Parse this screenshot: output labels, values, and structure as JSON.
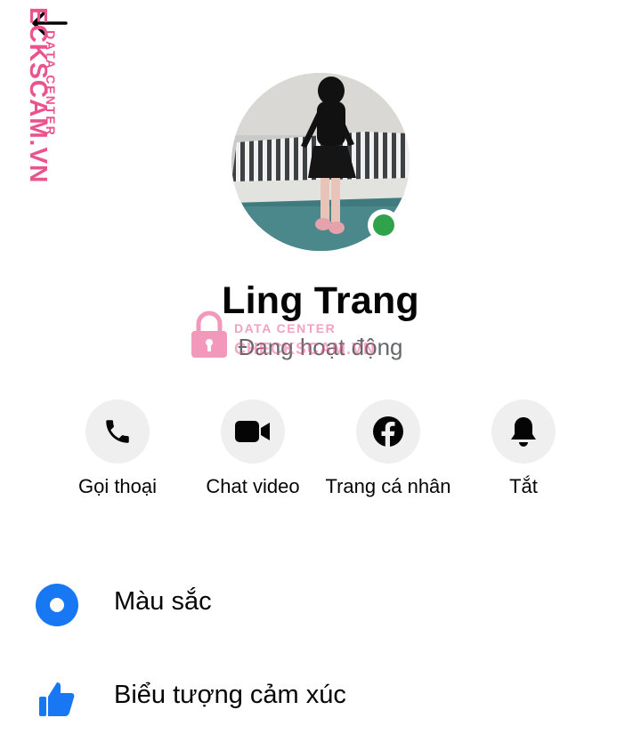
{
  "header": {
    "back_icon": "arrow-left-icon"
  },
  "watermark": {
    "vertical_text": "ECKSCAM.VN",
    "vertical_sub": "DATA CENTER",
    "center_line1": "DATA CENTER",
    "center_line2": "CHECKSCAM.VN",
    "color": "#e9548c"
  },
  "profile": {
    "name": "Ling Trang",
    "status": "Đang hoạt động",
    "online_color": "#31a24c"
  },
  "actions": [
    {
      "label": "Gọi thoại",
      "icon": "phone-icon"
    },
    {
      "label": "Chat video",
      "icon": "video-camera-icon"
    },
    {
      "label": "Trang cá nhân",
      "icon": "facebook-icon"
    },
    {
      "label": "Tắt",
      "icon": "bell-icon"
    }
  ],
  "menu": [
    {
      "label": "Màu sắc",
      "icon": "color-circle-icon"
    },
    {
      "label": "Biểu tượng cảm xúc",
      "icon": "thumbs-up-icon"
    }
  ],
  "colors": {
    "accent": "#1877f2",
    "text": "#050505",
    "secondary_text": "#65676b"
  }
}
